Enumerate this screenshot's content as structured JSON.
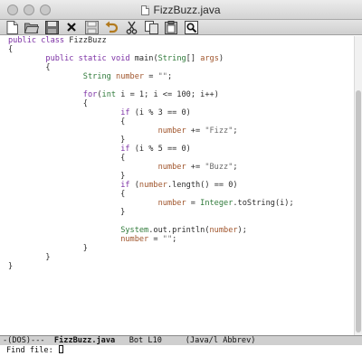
{
  "window": {
    "title": "FizzBuzz.java"
  },
  "toolbar": {
    "buttons": [
      {
        "name": "new-file-button",
        "icon": "new-file-icon"
      },
      {
        "name": "open-folder-button",
        "icon": "folder-icon"
      },
      {
        "name": "save-button",
        "icon": "save-disk-icon"
      },
      {
        "name": "close-buffer-button",
        "icon": "x-icon"
      },
      {
        "name": "save-as-button",
        "icon": "save-as-icon"
      },
      {
        "name": "undo-button",
        "icon": "undo-icon"
      },
      {
        "name": "cut-button",
        "icon": "scissors-icon"
      },
      {
        "name": "copy-button",
        "icon": "copy-icon"
      },
      {
        "name": "paste-button",
        "icon": "paste-icon"
      },
      {
        "name": "search-button",
        "icon": "magnifier-icon"
      }
    ]
  },
  "editor": {
    "lines": [
      "public class FizzBuzz",
      "{",
      "        public static void main(String[] args)",
      "        {",
      "                String number = \"\";",
      "",
      "                for(int i = 1; i <= 100; i++)",
      "                {",
      "                        if (i % 3 == 0)",
      "                        {",
      "                                number += \"Fizz\";",
      "                        }",
      "                        if (i % 5 == 0)",
      "                        {",
      "                                number += \"Buzz\";",
      "                        }",
      "                        if (number.length() == 0)",
      "                        {",
      "                                number = Integer.toString(i);",
      "                        }",
      "",
      "                        System.out.println(number);",
      "                        number = \"\";",
      "                }",
      "        }",
      "}"
    ]
  },
  "modeline": {
    "prefix": "-(DOS)---  ",
    "filename": "FizzBuzz.java",
    "position": "   Bot L10",
    "mode": "     (Java/l Abbrev)"
  },
  "minibuffer": {
    "prompt": "Find file: "
  }
}
